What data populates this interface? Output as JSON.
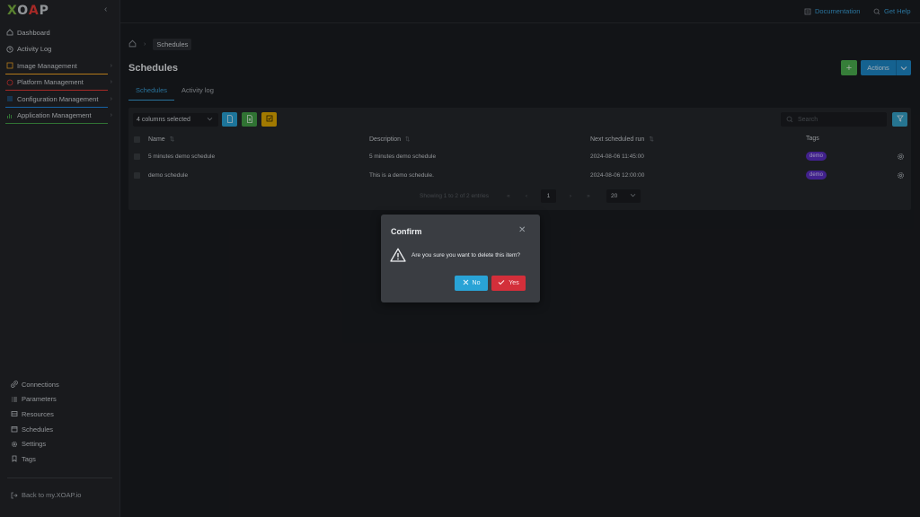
{
  "app": {
    "logo": "XOAP",
    "collapse_glyph": "‹"
  },
  "sidebar": {
    "items": [
      {
        "label": "Dashboard",
        "icon": "home-icon",
        "has_children": false
      },
      {
        "label": "Activity Log",
        "icon": "clock-icon",
        "has_children": false
      },
      {
        "label": "Image Management",
        "icon": "image-icon",
        "has_children": true,
        "accent": "#f9a825"
      },
      {
        "label": "Platform Management",
        "icon": "platform-icon",
        "has_children": true,
        "accent": "#e53935"
      },
      {
        "label": "Configuration Management",
        "icon": "config-icon",
        "has_children": true,
        "accent": "#1e88e5"
      },
      {
        "label": "Application Management",
        "icon": "apps-icon",
        "has_children": true,
        "accent": "#43a047"
      }
    ],
    "bottom_items": [
      {
        "label": "Connections",
        "icon": "link-icon"
      },
      {
        "label": "Parameters",
        "icon": "list-icon"
      },
      {
        "label": "Resources",
        "icon": "resources-icon"
      },
      {
        "label": "Schedules",
        "icon": "calendar-icon"
      },
      {
        "label": "Settings",
        "icon": "gear-icon"
      },
      {
        "label": "Tags",
        "icon": "bookmark-icon"
      }
    ],
    "back_link": "Back to my.XOAP.io"
  },
  "topbar": {
    "documentation": "Documentation",
    "get_help": "Get Help"
  },
  "breadcrumb": {
    "current": "Schedules"
  },
  "page": {
    "title": "Schedules",
    "add_label": "+",
    "actions_label": "Actions"
  },
  "tabs": [
    {
      "label": "Schedules",
      "active": true
    },
    {
      "label": "Activity log",
      "active": false
    }
  ],
  "table": {
    "columns_selected": "4 columns selected",
    "search_placeholder": "Search",
    "headers": [
      "Name",
      "Description",
      "Next scheduled run",
      "Tags"
    ],
    "rows": [
      {
        "name": "5 minutes demo schedule",
        "description": "5 minutes demo schedule",
        "next_run": "2024-08-06 11:45:00",
        "tag": "demo"
      },
      {
        "name": "demo schedule",
        "description": "This is a demo schedule.",
        "next_run": "2024-08-06 12:00:00",
        "tag": "demo"
      }
    ],
    "footer": {
      "summary": "Showing 1 to 2 of 2 entries",
      "current_page": "1",
      "page_size": "20"
    }
  },
  "dialog": {
    "title": "Confirm",
    "message": "Are you sure you want to delete this item?",
    "no_label": "No",
    "yes_label": "Yes"
  },
  "colors": {
    "accent_blue": "#29a3d6",
    "danger_red": "#d32f3a",
    "success_green": "#4caf50",
    "tag_purple": "#5a2fc2"
  }
}
